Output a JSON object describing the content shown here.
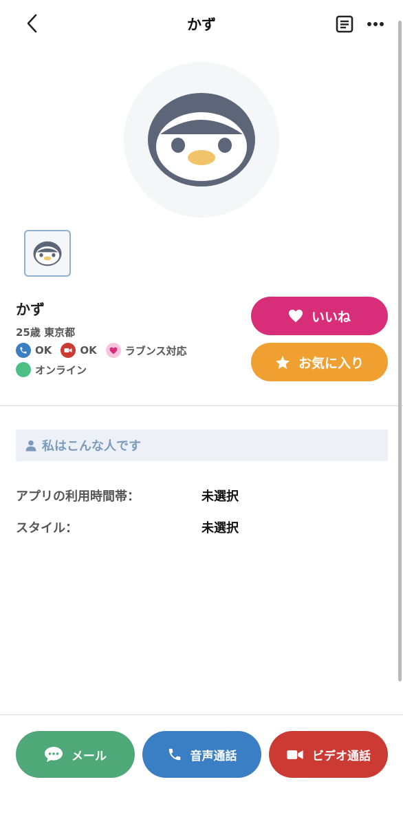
{
  "header": {
    "title": "かず"
  },
  "profile": {
    "name": "かず",
    "age_area": "25歳 東京都",
    "features": [
      {
        "label": "OK",
        "icon": "phone-icon",
        "color": "#3a7ec4"
      },
      {
        "label": "OK",
        "icon": "video-camera-icon",
        "color": "#cc3a34"
      },
      {
        "label": "ラブンス対応",
        "icon": "heart-icon",
        "color": "#f7c5dd"
      }
    ],
    "online_label": "オンライン"
  },
  "actions": {
    "like_label": "いいね",
    "favorite_label": "お気に入り"
  },
  "about": {
    "section_title": "私はこんな人です",
    "rows": [
      {
        "label": "アプリの利用時間帯：",
        "value": "未選択"
      },
      {
        "label": "スタイル：",
        "value": "未選択"
      }
    ]
  },
  "bottom_bar": {
    "mail_label": "メール",
    "voice_call_label": "音声通話",
    "video_call_label": "ビデオ通話"
  },
  "colors": {
    "like": "#d82e7a",
    "favorite": "#f0a031",
    "mail": "#4fa877",
    "voice": "#3a7ec4",
    "video": "#cc3a34",
    "online": "#4cbf84",
    "section_text": "#7c9bbb"
  }
}
